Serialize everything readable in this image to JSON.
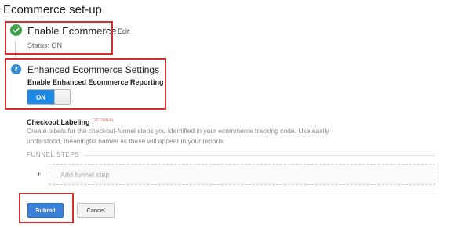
{
  "page_title": "Ecommerce set-up",
  "step1": {
    "title": "Enable Ecommerce",
    "edit_label": "Edit",
    "status": "Status: ON",
    "icon": "check-circle-icon",
    "icon_color": "#3da34a"
  },
  "step2": {
    "number": "2",
    "title": "Enhanced Ecommerce Settings",
    "toggle_label": "Enable Enhanced Ecommerce Reporting",
    "toggle_value": "ON",
    "toggle_color": "#1e88e5"
  },
  "checkout": {
    "title": "Checkout Labeling",
    "optional_tag": "OPTIONAL",
    "description": "Create labels for the checkout-funnel steps you identified in your ecommerce tracking code. Use easily understood, meaningful names as these will appear in your reports."
  },
  "funnel": {
    "label": "FUNNEL STEPS",
    "plus": "+",
    "add_step_placeholder": "Add funnel step"
  },
  "actions": {
    "submit_label": "Submit",
    "cancel_label": "Cancel",
    "submit_color": "#3b80d8"
  },
  "highlight_color": "#d32f2f"
}
